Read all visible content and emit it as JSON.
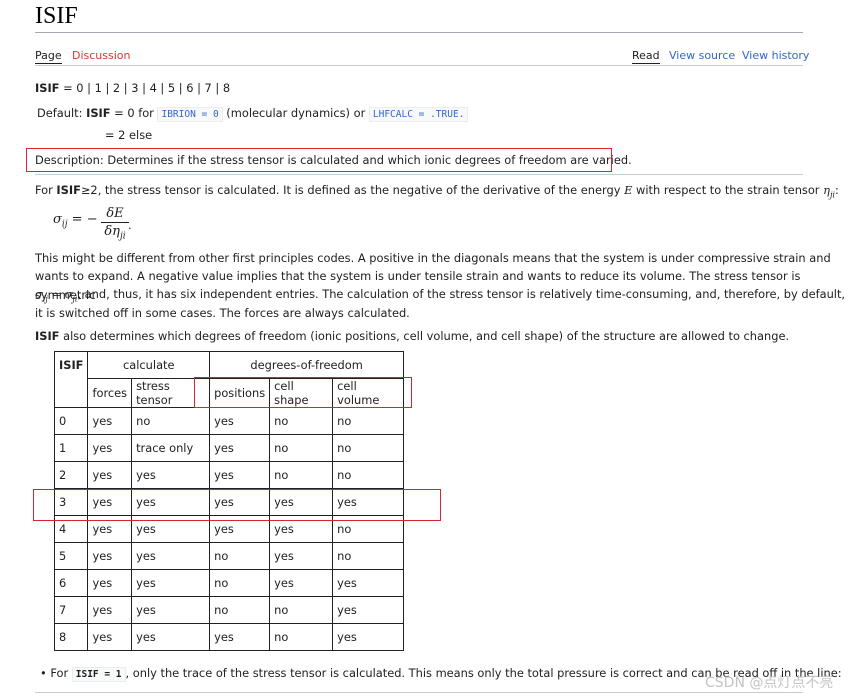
{
  "page": {
    "title": "ISIF",
    "tabs": {
      "page": "Page",
      "discussion": "Discussion",
      "read": "Read",
      "view_source": "View source",
      "view_history": "View history"
    }
  },
  "definition": {
    "tag": "ISIF",
    "values": "= 0 | 1 | 2 | 3 | 4 | 5 | 6 | 7 | 8",
    "default_label": "Default: ",
    "default_tag": "ISIF",
    "default_eq0": " = 0 for ",
    "ibrion_code": "IBRION = 0",
    "molecular": " (molecular dynamics) or ",
    "lhfcalc_code": "LHFCALC = .TRUE.",
    "else_line": "= 2 else",
    "description": "Description: Determines if the stress tensor is calculated and which ionic degrees of freedom are varied."
  },
  "intro": {
    "p1_pre": "For ",
    "p1_tag": "ISIF",
    "p1_cond": "≥2",
    "p1_text": ", the stress tensor is calculated. It is defined as the negative of the derivative of the energy ",
    "p1_E": "E",
    "p1_text2": " with respect to the strain tensor ",
    "p1_eta": "η",
    "p1_eta_sub": "ji",
    "p1_end": ":",
    "eq_lhs": "σ",
    "eq_lhs_sub": "ij",
    "eq_mid": " = −",
    "eq_num": "δE",
    "eq_den": "δη",
    "eq_den_sub": "ji",
    "eq_end": "."
  },
  "body": {
    "line1": "This might be different from other first principles codes. A positive in the diagonals means that the system is under compressive strain and",
    "line2": "wants to expand. A negative value implies that the system is under tensile strain and wants to reduce its volume. The stress tensor is symmetric",
    "line3_sym": "σ",
    "line3_sub1": "ij",
    "line3_eq": " = σ",
    "line3_sub2": "ji",
    "line3_text": ", and, thus, it has six independent entries. The calculation of the stress tensor is relatively time-consuming, and, therefore, by default,",
    "line4": "it is switched off in some cases. The forces are always calculated.",
    "isif_tag": "ISIF",
    "line5": " also determines which degrees of freedom (ionic positions, cell volume, and cell shape) of the structure are allowed to change."
  },
  "table": {
    "header_isif": "ISIF",
    "header_calculate": "calculate",
    "header_dof": "degrees-of-freedom",
    "subheaders": [
      "forces",
      "stress tensor",
      "positions",
      "cell shape",
      "cell volume"
    ],
    "rows": [
      [
        "0",
        "yes",
        "no",
        "yes",
        "no",
        "no"
      ],
      [
        "1",
        "yes",
        "trace only",
        "yes",
        "no",
        "no"
      ],
      [
        "2",
        "yes",
        "yes",
        "yes",
        "no",
        "no"
      ],
      [
        "3",
        "yes",
        "yes",
        "yes",
        "yes",
        "yes"
      ],
      [
        "4",
        "yes",
        "yes",
        "yes",
        "yes",
        "no"
      ],
      [
        "5",
        "yes",
        "yes",
        "no",
        "yes",
        "no"
      ],
      [
        "6",
        "yes",
        "yes",
        "no",
        "yes",
        "yes"
      ],
      [
        "7",
        "yes",
        "yes",
        "no",
        "no",
        "yes"
      ],
      [
        "8",
        "yes",
        "yes",
        "yes",
        "no",
        "yes"
      ]
    ]
  },
  "bullet": {
    "pre": "For ",
    "code": "ISIF = 1",
    "text": ", only the trace of the stress tensor is calculated. This means only the total pressure is correct and can be read off in the line:"
  },
  "watermark": "CSDN @点灯点不亮",
  "colors": {
    "annotation_red": "#d9232e",
    "link_blue": "#3366cc",
    "discussion_red": "#dd3333"
  }
}
